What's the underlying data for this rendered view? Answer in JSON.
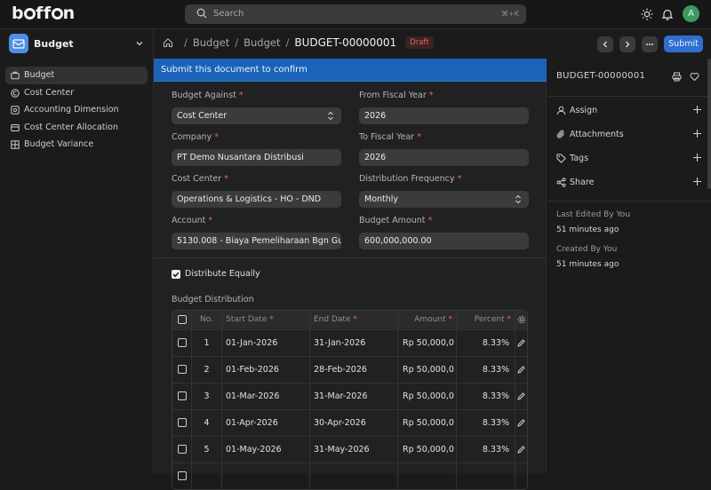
{
  "app": {
    "logo_prefix": "b",
    "logo_suffix": "ff",
    "logo_end": "n",
    "logo_full": "boffon",
    "avatar_initial": "A"
  },
  "search": {
    "placeholder": "Search",
    "shortcut": "⌘+K"
  },
  "sidebar": {
    "workspace": "Budget",
    "items": [
      {
        "label": "Budget",
        "icon": "budget-icon",
        "active": true
      },
      {
        "label": "Cost Center",
        "icon": "cost-center-icon",
        "active": false
      },
      {
        "label": "Accounting Dimension",
        "icon": "accounting-dimension-icon",
        "active": false
      },
      {
        "label": "Cost Center Allocation",
        "icon": "allocation-icon",
        "active": false
      },
      {
        "label": "Budget Variance",
        "icon": "grid-icon",
        "active": false
      }
    ]
  },
  "breadcrumb": {
    "items": [
      "Budget",
      "Budget"
    ],
    "current": "BUDGET-00000001",
    "status": "Draft"
  },
  "header": {
    "submit_label": "Submit"
  },
  "banner": "Submit this document to confirm",
  "form": {
    "budget_against": {
      "label": "Budget Against",
      "value": "Cost Center"
    },
    "from_fiscal_year": {
      "label": "From Fiscal Year",
      "value": "2026"
    },
    "company": {
      "label": "Company",
      "value": "PT Demo Nusantara Distribusi"
    },
    "to_fiscal_year": {
      "label": "To Fiscal Year",
      "value": "2026"
    },
    "cost_center": {
      "label": "Cost Center",
      "value": "Operations & Logistics - HO - DND"
    },
    "distribution_frequency": {
      "label": "Distribution Frequency",
      "value": "Monthly"
    },
    "account": {
      "label": "Account",
      "value": "5130.008 - Biaya Pemeliharaan Bgn Gu"
    },
    "budget_amount": {
      "label": "Budget Amount",
      "value": "600,000,000.00"
    },
    "distribute_equally": {
      "label": "Distribute Equally",
      "checked": true
    }
  },
  "distribution": {
    "label": "Budget Distribution",
    "columns": {
      "no": "No.",
      "start": "Start Date",
      "end": "End Date",
      "amount": "Amount",
      "percent": "Percent"
    },
    "rows": [
      {
        "no": "1",
        "start": "01-Jan-2026",
        "end": "31-Jan-2026",
        "amount": "Rp 50,000,0",
        "percent": "8.33%"
      },
      {
        "no": "2",
        "start": "01-Feb-2026",
        "end": "28-Feb-2026",
        "amount": "Rp 50,000,0",
        "percent": "8.33%"
      },
      {
        "no": "3",
        "start": "01-Mar-2026",
        "end": "31-Mar-2026",
        "amount": "Rp 50,000,0",
        "percent": "8.33%"
      },
      {
        "no": "4",
        "start": "01-Apr-2026",
        "end": "30-Apr-2026",
        "amount": "Rp 50,000,0",
        "percent": "8.33%"
      },
      {
        "no": "5",
        "start": "01-May-2026",
        "end": "31-May-2026",
        "amount": "Rp 50,000,0",
        "percent": "8.33%"
      }
    ]
  },
  "side": {
    "doc_name": "BUDGET-00000001",
    "actions": [
      "Assign",
      "Attachments",
      "Tags",
      "Share"
    ],
    "last_edited_label": "Last Edited By You",
    "last_edited_value": "51 minutes ago",
    "created_label": "Created By You",
    "created_value": "51 minutes ago"
  },
  "colors": {
    "accent": "#2f6fd0",
    "banner": "#1a63b8",
    "draft": "#e85f5f",
    "required": "#e06565"
  }
}
